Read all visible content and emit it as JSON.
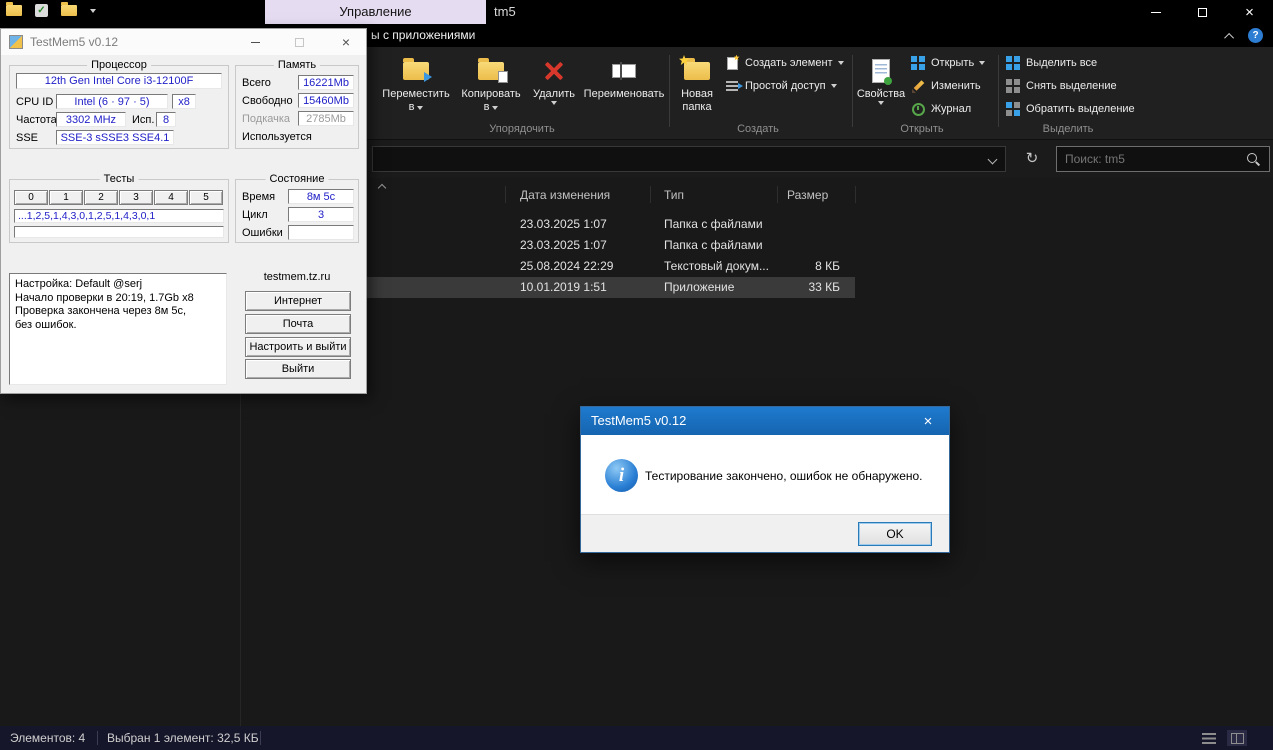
{
  "icons": {
    "close_glyph": "×",
    "refresh_glyph": "↻",
    "help_glyph": "?",
    "info_glyph": "i",
    "check_glyph": "✓"
  },
  "explorer": {
    "titlebar": {
      "manage_tab": "Управление",
      "window_title": "tm5"
    },
    "ribbon_tabs": {
      "contextual_partial": "ы с приложениями"
    },
    "ribbon": {
      "move_to_1": "Переместить",
      "move_to_2": "в",
      "copy_to_1": "Копировать",
      "copy_to_2": "в",
      "delete": "Удалить",
      "rename": "Переименовать",
      "new_folder_1": "Новая",
      "new_folder_2": "папка",
      "new_item": "Создать элемент",
      "easy_access": "Простой доступ",
      "properties": "Свойства",
      "open": "Открыть",
      "edit": "Изменить",
      "history": "Журнал",
      "select_all": "Выделить все",
      "select_none": "Снять выделение",
      "invert_selection": "Обратить выделение",
      "group_organize": "Упорядочить",
      "group_new": "Создать",
      "group_open": "Открыть",
      "group_select": "Выделить"
    },
    "address": {
      "search_placeholder": "Поиск: tm5"
    },
    "columns": {
      "date": "Дата изменения",
      "type": "Тип",
      "size": "Размер"
    },
    "rows": [
      {
        "date": "23.03.2025 1:07",
        "type": "Папка с файлами",
        "size": ""
      },
      {
        "date": "23.03.2025 1:07",
        "type": "Папка с файлами",
        "size": ""
      },
      {
        "date": "25.08.2024 22:29",
        "type": "Текстовый докум...",
        "size": "8 КБ"
      },
      {
        "date": "10.01.2019 1:51",
        "type": "Приложение",
        "size": "33 КБ"
      }
    ],
    "statusbar": {
      "count": "Элементов: 4",
      "selection": "Выбран 1 элемент: 32,5 КБ"
    }
  },
  "testmem": {
    "window_title": "TestMem5 v0.12",
    "processor": {
      "group_label": "Процессор",
      "cpu_name": "12th Gen Intel Core i3-12100F",
      "cpu_id_label": "CPU ID",
      "cpu_id_value": "Intel (6 · 97 · 5)",
      "cpu_threads": "x8",
      "freq_label": "Частота",
      "freq_value": "3302 MHz",
      "usage_label": "Исп.",
      "usage_value": "8",
      "sse_label": "SSE",
      "sse_value": "SSE-3 sSSE3 SSE4.1"
    },
    "memory": {
      "group_label": "Память",
      "total_label": "Всего",
      "total_value": "16221Mb",
      "free_label": "Свободно",
      "free_value": "15460Mb",
      "swap_label": "Подкачка",
      "swap_value": "2785Mb",
      "used_label": "Используется"
    },
    "tests": {
      "group_label": "Тесты",
      "buttons": [
        "0",
        "1",
        "2",
        "3",
        "4",
        "5"
      ],
      "sequence": "...1,2,5,1,4,3,0,1,2,5,1,4,3,0,1"
    },
    "state": {
      "group_label": "Состояние",
      "time_label": "Время",
      "time_value": "8м 5с",
      "cycle_label": "Цикл",
      "cycle_value": "3",
      "errors_label": "Ошибки",
      "errors_value": ""
    },
    "log": {
      "line1": "Настройка: Default @serj",
      "line2": "Начало проверки в 20:19, 1.7Gb x8",
      "line3": "Проверка закончена через 8м 5с,",
      "line4": "без ошибок."
    },
    "site": {
      "label": "testmem.tz.ru",
      "internet": "Интернет",
      "mail": "Почта",
      "configure": "Настроить и выйти",
      "exit": "Выйти"
    }
  },
  "dialog": {
    "title": "TestMem5 v0.12",
    "message": "Тестирование закончено, ошибок не обнаружено.",
    "ok": "OK"
  }
}
